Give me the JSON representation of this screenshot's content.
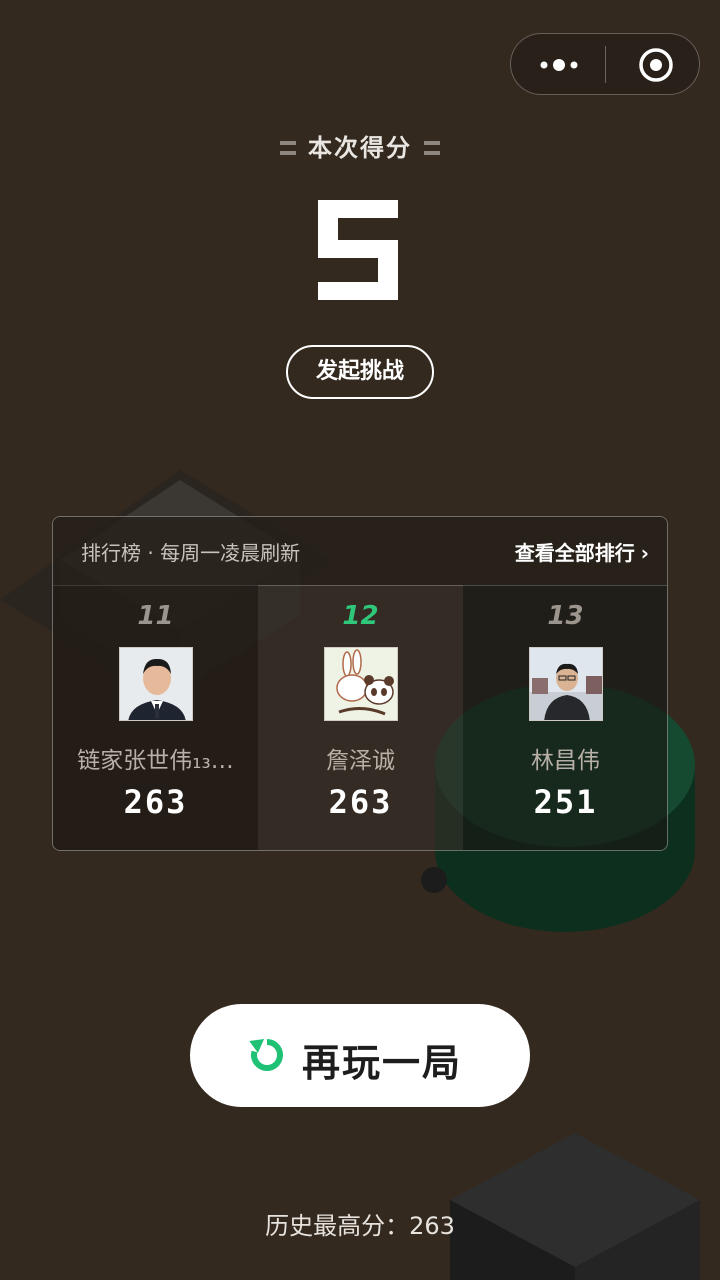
{
  "score_title": "本次得分",
  "score": "5",
  "challenge_label": "发起挑战",
  "leaderboard": {
    "caption": "排行榜 · 每周一凌晨刷新",
    "view_all": "查看全部排行",
    "entries": [
      {
        "rank": "11",
        "name": "链家张世伟₁₃…",
        "score": "263",
        "is_me": false
      },
      {
        "rank": "12",
        "name": "詹泽诚",
        "score": "263",
        "is_me": true
      },
      {
        "rank": "13",
        "name": "林昌伟",
        "score": "251",
        "is_me": false
      }
    ]
  },
  "replay_label": "再玩一局",
  "best_score": "历史最高分：263",
  "icons": {
    "more": "more-icon",
    "close": "target-close-icon",
    "replay": "refresh-icon",
    "chevron": "chevron-right-icon"
  },
  "colors": {
    "background": "#33291f",
    "accent": "#2fc77a"
  }
}
